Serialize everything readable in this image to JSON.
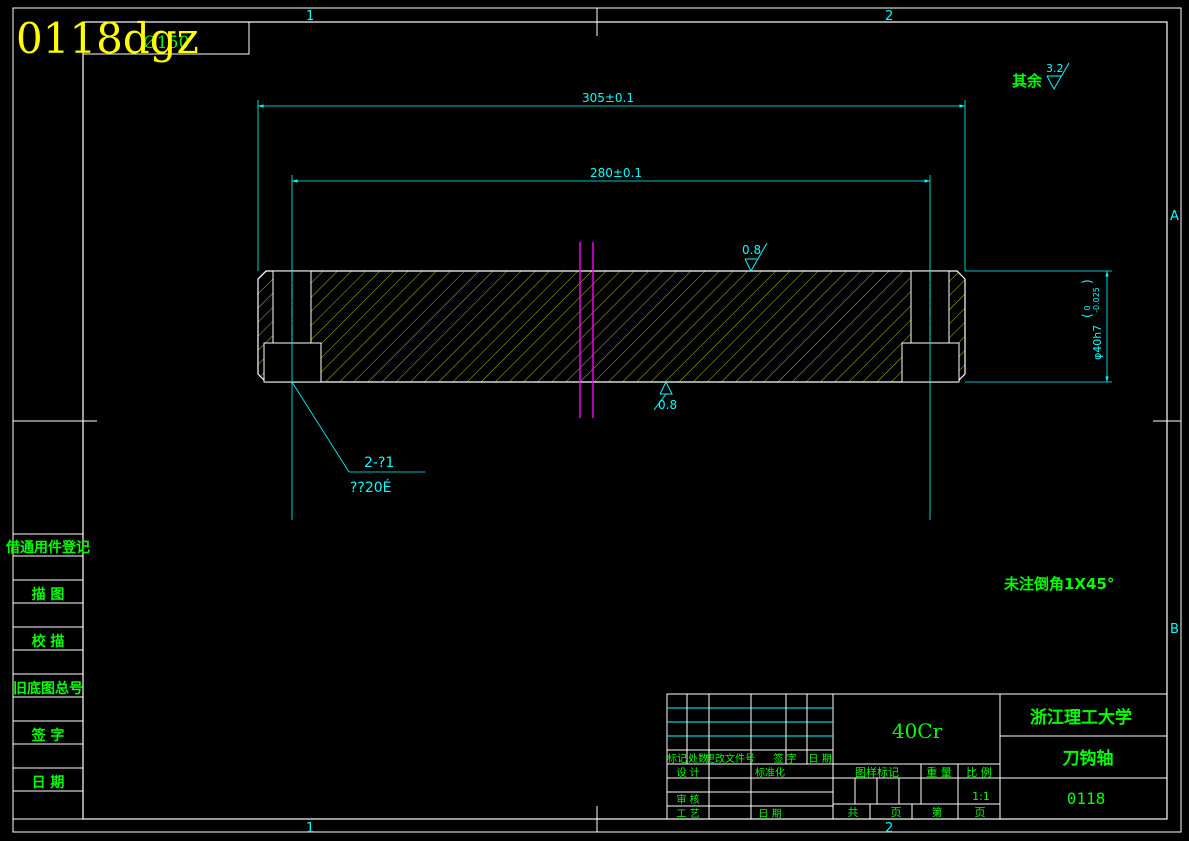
{
  "watermark": "0118dgz",
  "corner_box": "Ø150",
  "zones": {
    "top_1": "1",
    "top_2": "2",
    "bottom_1": "1",
    "bottom_2": "2",
    "right_a": "A",
    "right_b": "B"
  },
  "roughness_general": {
    "label": "其余",
    "value": "3.2"
  },
  "dimensions": {
    "overall_length": "305±0.1",
    "inner_length": "280±0.1",
    "diameter_main": "φ40h7",
    "tol_upper": "0",
    "tol_lower": "-0.025",
    "roughness_top": "0.8",
    "roughness_bottom": "0.8",
    "hole_count": "2-?1",
    "hole_spec": "??20É"
  },
  "note_chamfer": "未注倒角1X45°",
  "side_table": [
    "借通用件登记",
    "描 图",
    "校 描",
    "旧底图总号",
    "签 字",
    "日 期"
  ],
  "title_block": {
    "material": "40Cr",
    "school": "浙江理工大学",
    "part_name": "刀钩轴",
    "drawing_no": "0118",
    "rev_headers": [
      "标记",
      "处数",
      "更改文件号",
      "签 字",
      "日 期"
    ],
    "design": "设 计",
    "standardize": "标准化",
    "review": "审 核",
    "process": "工 艺",
    "date": "日 期",
    "stage_label": "图样标记",
    "weight_label": "重 量",
    "scale_label": "比 例",
    "scale": "1:1",
    "total": "共",
    "sheet_unit_1": "页",
    "nth": "第",
    "sheet_unit_2": "页"
  },
  "colors": {
    "frame": "#ffffff",
    "dim": "#00ffff",
    "text": "#00ff00",
    "hatch": "#ffff00",
    "center": "#ff00ff",
    "watermark": "#ffff00"
  }
}
